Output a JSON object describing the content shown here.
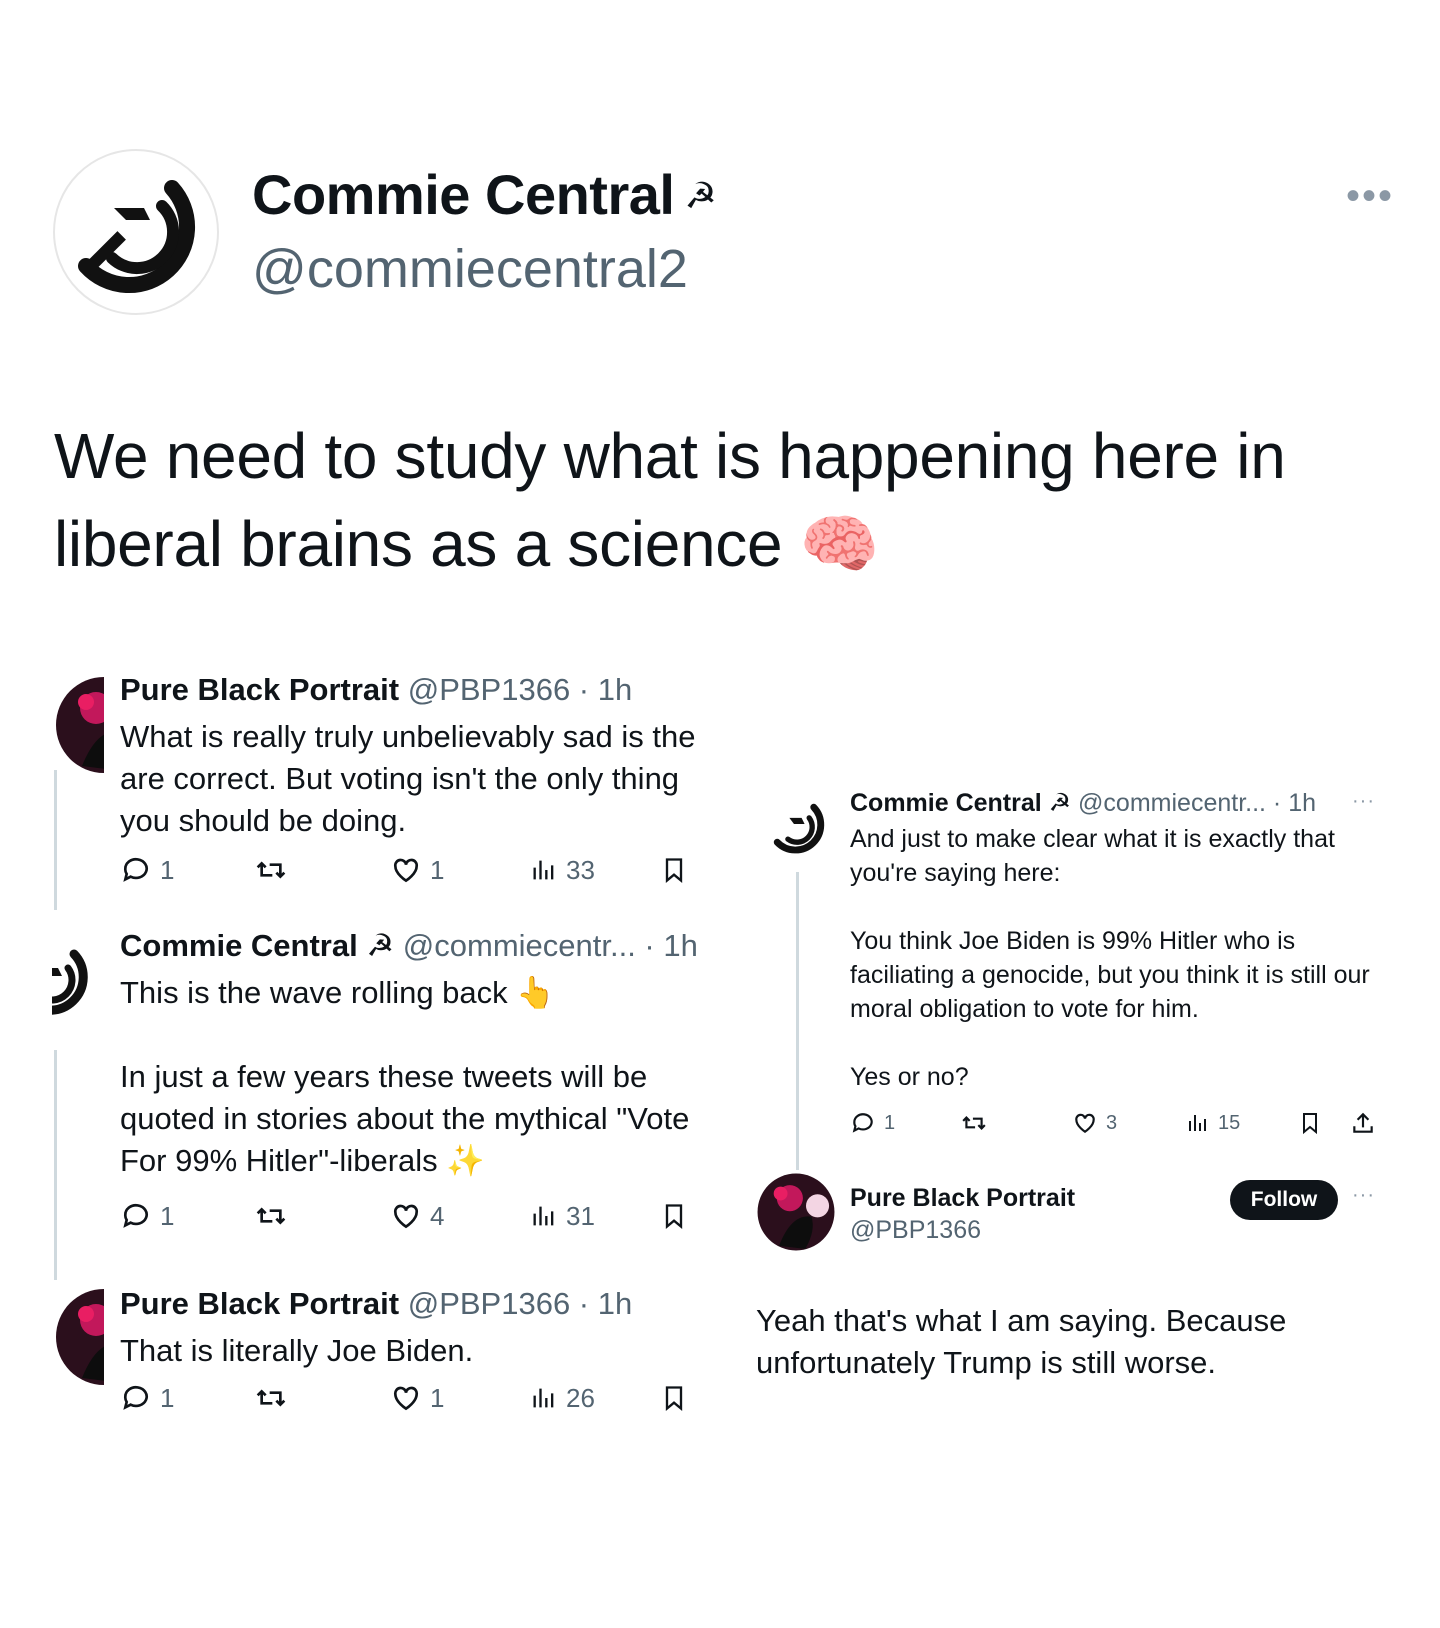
{
  "main_tweet": {
    "author_name": "Commie Central",
    "author_symbol": "☭",
    "author_handle": "@commiecentral2",
    "more_icon": "•••",
    "text": "We need to study what is happening here in liberal brains as a science 🧠"
  },
  "left_thread": [
    {
      "name": "Pure Black Portrait",
      "meta": "@PBP1366 · 1h",
      "text": "What is really truly unbelievably sad is the are correct. But voting isn't the only thing you should be doing.",
      "replies": "1",
      "likes": "1",
      "views": "33"
    },
    {
      "name": "Commie Central",
      "symbol": "☭",
      "meta": "@commiecentr... · 1h",
      "text": "This is the wave rolling back 👆\n\nIn just a few years these tweets will be quoted in stories about the mythical \"Vote For 99% Hitler\"-liberals ✨",
      "replies": "1",
      "likes": "4",
      "views": "31"
    },
    {
      "name": "Pure Black Portrait",
      "meta": "@PBP1366 · 1h",
      "text": "That is literally Joe Biden.",
      "replies": "1",
      "likes": "1",
      "views": "26"
    }
  ],
  "right_thread": {
    "tweet": {
      "name": "Commie Central",
      "symbol": "☭",
      "meta": "@commiecentr... · 1h",
      "text": "And just to make clear what it is exactly that you're saying here:\n\nYou think Joe Biden is 99% Hitler who is faciliating a genocide, but you think it is still our moral obligation to vote for him.\n\nYes or no?",
      "replies": "1",
      "likes": "3",
      "views": "15"
    },
    "reply": {
      "name": "Pure Black Portrait",
      "handle": "@PBP1366",
      "follow_label": "Follow",
      "text": "Yeah that's what I am saying. Because unfortunately Trump is still worse."
    }
  },
  "colors": {
    "text": "#0f1419",
    "secondary": "#536471",
    "line": "#cfd9de",
    "portrait_pink": "#c2185b"
  }
}
